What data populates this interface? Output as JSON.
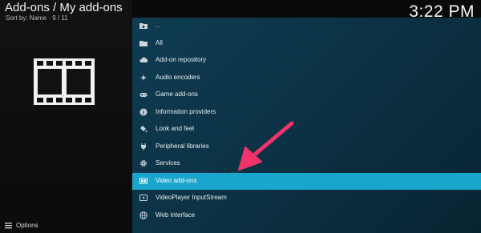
{
  "header": {
    "title": "Add-ons / My add-ons",
    "sort_info": "Sort by: Name  ·  9 / 11",
    "clock": "3:22 PM"
  },
  "footer": {
    "options_label": "Options"
  },
  "list": {
    "items": [
      {
        "label": "..",
        "icon": "folder-up-icon"
      },
      {
        "label": "All",
        "icon": "folder-icon"
      },
      {
        "label": "Add-on repository",
        "icon": "cloud-icon"
      },
      {
        "label": "Audio encoders",
        "icon": "sparkle-icon"
      },
      {
        "label": "Game add-ons",
        "icon": "gamepad-icon"
      },
      {
        "label": "Information providers",
        "icon": "info-icon"
      },
      {
        "label": "Look and feel",
        "icon": "paint-bucket-icon"
      },
      {
        "label": "Peripheral libraries",
        "icon": "plug-icon"
      },
      {
        "label": "Services",
        "icon": "gear-icon"
      },
      {
        "label": "Video add-ons",
        "icon": "film-icon"
      },
      {
        "label": "VideoPlayer InputStream",
        "icon": "play-stream-icon"
      },
      {
        "label": "Web interface",
        "icon": "globe-icon"
      }
    ],
    "selected_index": 9
  },
  "colors": {
    "selection": "#1aa6cc",
    "arrow": "#f0336b"
  }
}
